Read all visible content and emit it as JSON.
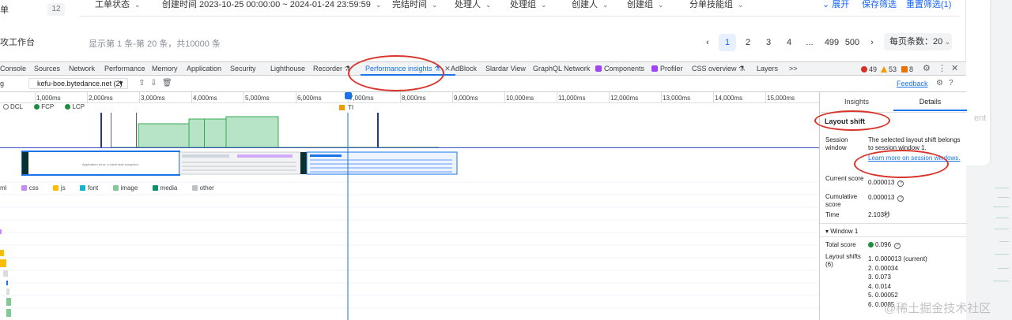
{
  "app": {
    "side_item_1": "单",
    "side_item_2": "攻工作台",
    "badge_count": "12",
    "filters": [
      {
        "label": "工单状态"
      },
      {
        "label": "创建时间  2023-10-25 00:00:00 ~ 2024-01-24 23:59:59"
      },
      {
        "label": "完结时间"
      },
      {
        "label": "处理人"
      },
      {
        "label": "处理组"
      },
      {
        "label": "创建人"
      },
      {
        "label": "创建组"
      },
      {
        "label": "分单技能组"
      }
    ],
    "expand_label": "展开",
    "save_filter_label": "保存筛选",
    "reset_filter_label": "重置筛选(1)",
    "summary": "显示第 1 条-第 20 条，共10000 条",
    "pages": [
      "1",
      "2",
      "3",
      "4",
      "...",
      "499",
      "500"
    ],
    "page_size": "每页条数：20",
    "right_ghost_text": "ent"
  },
  "devtools": {
    "tabs": [
      {
        "label": "Console"
      },
      {
        "label": "Sources"
      },
      {
        "label": "Network"
      },
      {
        "label": "Performance"
      },
      {
        "label": "Memory"
      },
      {
        "label": "Application"
      },
      {
        "label": "Security"
      },
      {
        "label": "Lighthouse"
      },
      {
        "label": "Recorder ⚗"
      },
      {
        "label": "Performance insights ⚗"
      },
      {
        "label": "AdBlock"
      },
      {
        "label": "Slardar View"
      },
      {
        "label": "GraphQL Network"
      },
      {
        "label": "Components"
      },
      {
        "label": "Profiler"
      },
      {
        "label": "CSS overview ⚗"
      },
      {
        "label": "Layers"
      },
      {
        "label": ">>"
      }
    ],
    "errors": "49",
    "warnings": "53",
    "issues": "8",
    "toolbar_left": "g",
    "recording_select": "kefu-boe.bytedance.net (2)",
    "feedback_label": "Feedback"
  },
  "timeline": {
    "ticks": [
      "1,000ms",
      "2,000ms",
      "3,000ms",
      "4,000ms",
      "5,000ms",
      "6,000ms",
      "7,000ms",
      "8,000ms",
      "9,000ms",
      "10,000ms",
      "11,000ms",
      "12,000ms",
      "13,000ms",
      "14,000ms",
      "15,000ms"
    ],
    "markers": {
      "dcl": "DCL",
      "fcp": "FCP",
      "lcp": "LCP",
      "ti": "TI"
    },
    "network_legend": [
      {
        "label": "ml",
        "color": ""
      },
      {
        "label": "css",
        "color": "#c58af9"
      },
      {
        "label": "js",
        "color": "#fbbc04"
      },
      {
        "label": "font",
        "color": "#12b5cb"
      },
      {
        "label": "image",
        "color": "#81c995"
      },
      {
        "label": "media",
        "color": "#0d9267"
      },
      {
        "label": "other",
        "color": "#bdc1c6"
      }
    ],
    "screenshot_caption": "Application error: a client-side exception"
  },
  "details": {
    "tab_insights": "Insights",
    "tab_details": "Details",
    "title": "Layout shift",
    "session_window_label": "Session window",
    "session_window_text": "The selected layout shift belongs to session window 1.",
    "session_window_link": "Learn more on session windows.",
    "current_score_label": "Current score",
    "current_score": "0.000013",
    "cumulative_score_label": "Cumulative score",
    "cumulative_score": "0.000013",
    "time_label": "Time",
    "time": "2.103秒",
    "window_heading": "▾ Window 1",
    "total_score_label": "Total score",
    "total_score": "0.096",
    "layout_shifts_label": "Layout shifts (6)",
    "shifts": [
      "1. 0.000013 (current)",
      "2. 0.00034",
      "3. 0.073",
      "4. 0.014",
      "5. 0.00052",
      "6. 0.0085"
    ]
  },
  "watermark": "@稀土掘金技术社区",
  "colors": {
    "accent": "#1a73e8",
    "annotation": "#d9342b",
    "app_link": "#1664ff"
  }
}
